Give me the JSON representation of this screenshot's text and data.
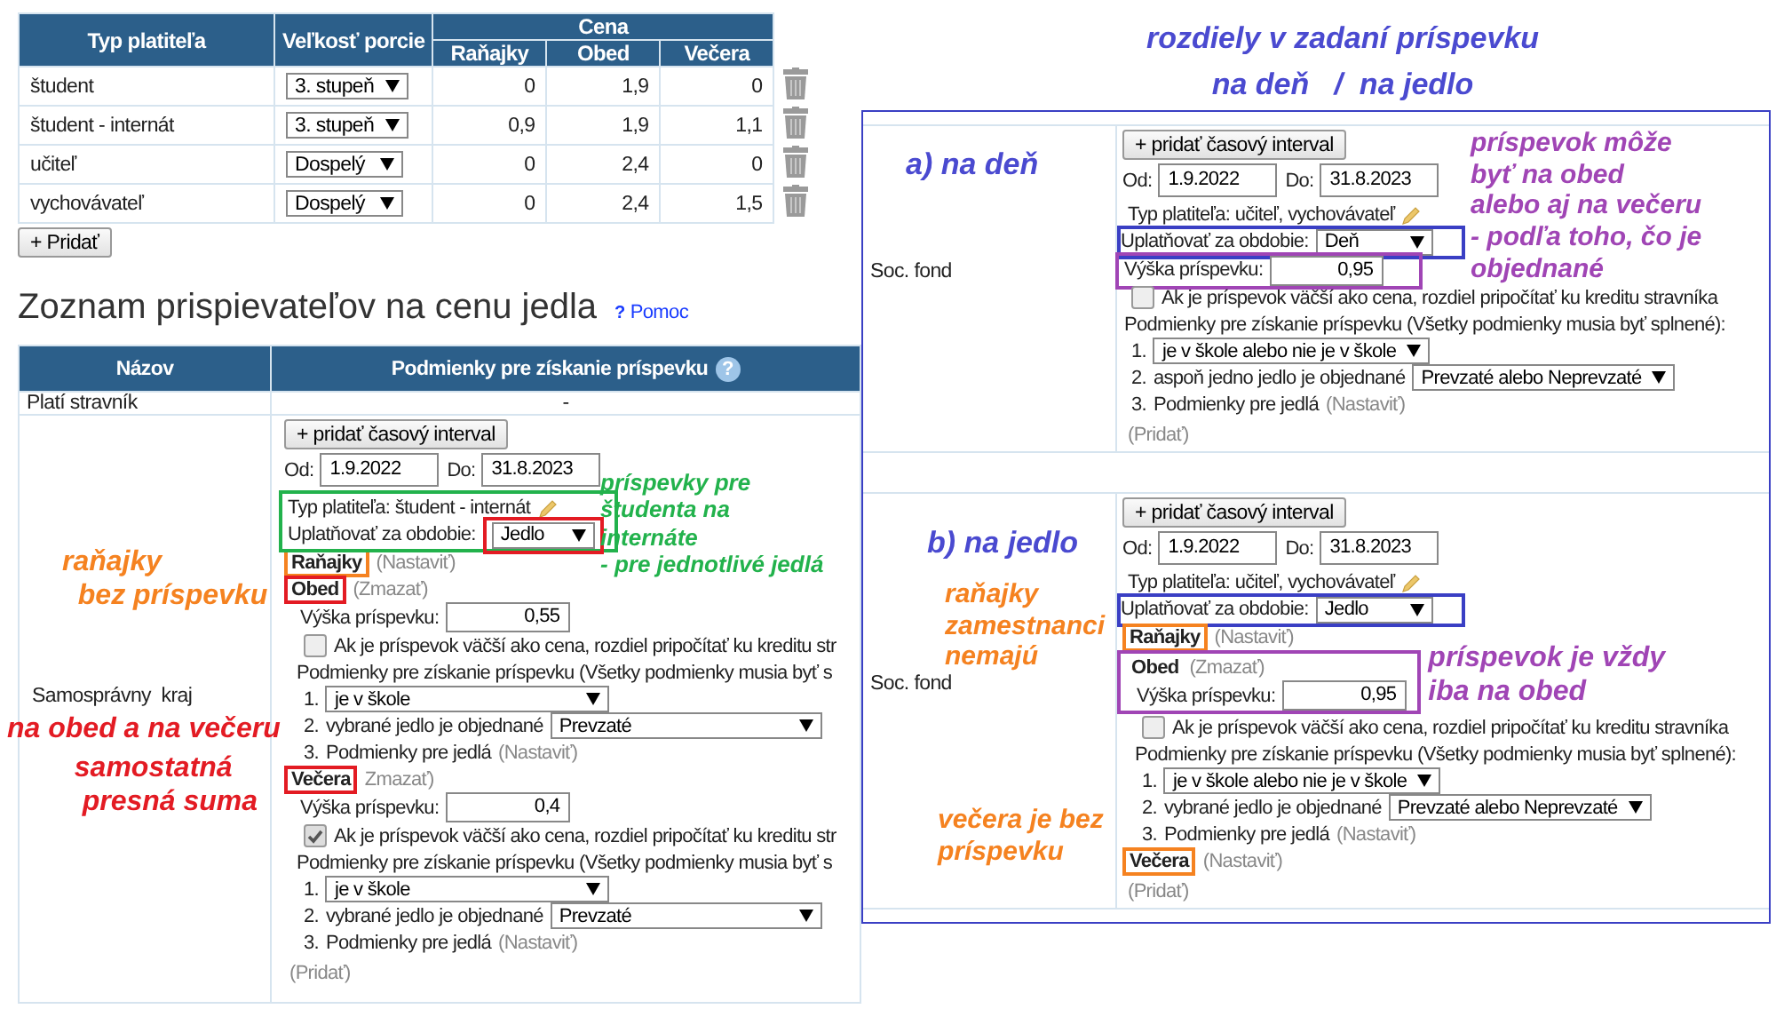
{
  "payer_table": {
    "headers": {
      "payer": "Typ platiteľa",
      "portion": "Veľkosť porcie",
      "price": "Cena",
      "meals": [
        "Raňajky",
        "Obed",
        "Večera"
      ]
    },
    "rows": [
      {
        "payer": "študent",
        "portion": "3. stupeň",
        "prices": [
          "0",
          "1,9",
          "0"
        ]
      },
      {
        "payer": "študent - internát",
        "portion": "3. stupeň",
        "prices": [
          "0,9",
          "1,9",
          "1,1"
        ]
      },
      {
        "payer": "učiteľ",
        "portion": "Dospelý",
        "prices": [
          "0",
          "2,4",
          "0"
        ]
      },
      {
        "payer": "vychovávateľ",
        "portion": "Dospelý",
        "prices": [
          "0",
          "2,4",
          "1,5"
        ]
      }
    ],
    "add_button": "+ Pridať"
  },
  "heading": {
    "title": "Zoznam prispievateľov na cenu jedla",
    "help_mark": "?",
    "help_link": "Pomoc"
  },
  "contributors": {
    "headers": [
      "Názov",
      "Podmienky pre získanie príspevku"
    ],
    "header_help": "?",
    "plain_row": {
      "name": "Platí stravník",
      "value": "-"
    },
    "detail_row": {
      "name_column": [
        {
          "kind": "note",
          "lines": [
            "raňajky",
            "  bez príspevku"
          ],
          "color": "#f58220"
        },
        {
          "kind": "name",
          "text": "Samosprávny  kraj"
        },
        {
          "kind": "note",
          "lines": [
            "na obed a na večeru"
          ],
          "color": "#e31b23"
        },
        {
          "kind": "note",
          "lines": [
            "  samostatná",
            "   presná suma"
          ],
          "color": "#e31b23"
        }
      ],
      "config": {
        "add_interval": "+ pridať časový interval",
        "from_label": "Od:",
        "from": "1.9.2022",
        "to_label": "Do:",
        "to": "31.8.2023",
        "payer_line": "Typ platiteľa: študent - internát",
        "period_label": "Uplatňovať za obdobie:",
        "period": "Jedlo",
        "group_box": {
          "color": "#22b24c"
        },
        "period_box": {
          "kind": "select",
          "color": "#e31b23"
        },
        "side_note": {
          "kind": "beside_group",
          "lines": [
            "príspevky pre",
            "študenta na",
            "internáte",
            "- pre jednotlivé jedlá"
          ],
          "color": "#22b24c"
        },
        "meals": [
          {
            "name": "Raňajky",
            "action": "(Nastaviť)",
            "box": {
              "color": "#f58220"
            }
          },
          {
            "name": "Obed",
            "action": "(Zmazať)",
            "box": {
              "color": "#e31b23"
            },
            "settings": {
              "amount_label": "Výška príspevku:",
              "amount": "0,55",
              "credit_checked": false,
              "credit_text": "Ak je príspevok väčší ako cena, rozdiel pripočítať ku kreditu str",
              "conditions_title": "Podmienky pre získanie príspevku (Všetky podmienky musia byť s",
              "conditions": [
                {
                  "num": "1.",
                  "select": "je v škole"
                },
                {
                  "num": "2.",
                  "label": "vybrané jedlo je objednané",
                  "select": "Prevzaté"
                },
                {
                  "num": "3.",
                  "label": "Podmienky pre jedlá",
                  "link": "(Nastaviť)"
                }
              ]
            }
          },
          {
            "name": "Večera",
            "action": "Zmazať)",
            "box": {
              "color": "#e31b23"
            },
            "settings": {
              "amount_label": "Výška príspevku:",
              "amount": "0,4",
              "credit_checked": true,
              "credit_text": "Ak je príspevok väčší ako cena, rozdiel pripočítať ku kreditu str",
              "conditions_title": "Podmienky pre získanie príspevku (Všetky podmienky musia byť s",
              "conditions": [
                {
                  "num": "1.",
                  "select": "je v škole"
                },
                {
                  "num": "2.",
                  "label": "vybrané jedlo je objednané",
                  "select": "Prevzaté"
                },
                {
                  "num": "3.",
                  "label": "Podmienky pre jedlá",
                  "link": "(Nastaviť)"
                }
              ]
            }
          }
        ],
        "add_link": "(Pridať)"
      }
    }
  },
  "comparison": {
    "title": [
      "rozdiely v zadaní príspevku",
      "na deň   /  na jedlo"
    ],
    "sections": [
      {
        "name_column": [
          {
            "kind": "note",
            "lines": [
              "a) na deň"
            ],
            "color": "#4a4ad0"
          },
          {
            "kind": "name",
            "text": "Soc. fond"
          }
        ],
        "config": {
          "add_interval": "+ pridať časový interval",
          "from_label": "Od:",
          "from": "1.9.2022",
          "to_label": "Do:",
          "to": "31.8.2023",
          "payer_line": "Typ platiteľa: učiteľ, vychovávateľ",
          "period_label": "Uplatňovať za obdobie:",
          "period": "Deň",
          "period_box": {
            "kind": "line",
            "color": "#3a3fc4"
          },
          "side_note": {
            "kind": "beside_top",
            "lines": [
              "príspevok môže",
              "byť na obed",
              "alebo aj na večeru",
              "- podľa toho, čo je",
              "objednané"
            ],
            "color": "#a045b5"
          },
          "settings": {
            "amount_label": "Výška príspevku:",
            "amount": "0,95",
            "amount_box": {
              "color": "#a045b5"
            },
            "credit_checked": false,
            "credit_text": "Ak je príspevok väčší ako cena, rozdiel pripočítať ku kreditu stravníka",
            "conditions_title": "Podmienky pre získanie príspevku (Všetky podmienky musia byť splnené):",
            "conditions": [
              {
                "num": "1.",
                "select": "je v škole alebo nie je v škole"
              },
              {
                "num": "2.",
                "label": "aspoň jedno jedlo je objednané",
                "select": "Prevzaté alebo Neprevzaté"
              },
              {
                "num": "3.",
                "label": "Podmienky pre jedlá",
                "link": "(Nastaviť)"
              }
            ]
          },
          "add_link": "(Pridať)"
        }
      },
      {
        "name_column": [
          {
            "kind": "note",
            "lines": [
              "b) na jedlo"
            ],
            "color": "#4a4ad0"
          },
          {
            "kind": "note",
            "lines": [
              "raňajky",
              "zamestnanci",
              "nemajú"
            ],
            "color": "#f58220"
          },
          {
            "kind": "name",
            "text": "Soc. fond"
          },
          {
            "kind": "note",
            "lines": [
              "večera je bez",
              "príspevku"
            ],
            "color": "#f58220"
          }
        ],
        "config": {
          "add_interval": "+ pridať časový interval",
          "from_label": "Od:",
          "from": "1.9.2022",
          "to_label": "Do:",
          "to": "31.8.2023",
          "payer_line": "Typ platiteľa: učiteľ, vychovávateľ",
          "period_label": "Uplatňovať za obdobie:",
          "period": "Jedlo",
          "period_box": {
            "kind": "line",
            "color": "#3a3fc4"
          },
          "meals": [
            {
              "name": "Raňajky",
              "action": "(Nastaviť)",
              "box": {
                "color": "#f58220"
              }
            },
            {
              "name": "Obed",
              "action": "(Zmazať)",
              "group_box": {
                "color": "#a045b5"
              },
              "group_note": {
                "lines": [
                  "príspevok je vždy",
                  "iba na obed"
                ],
                "color": "#a045b5"
              },
              "settings": {
                "amount_label": "Výška príspevku:",
                "amount": "0,95",
                "credit_checked": false,
                "credit_text": "Ak je príspevok väčší ako cena, rozdiel pripočítať ku kreditu stravníka",
                "conditions_title": "Podmienky pre získanie príspevku (Všetky podmienky musia byť splnené):",
                "conditions": [
                  {
                    "num": "1.",
                    "select": "je v škole alebo nie je v škole"
                  },
                  {
                    "num": "2.",
                    "label": "vybrané jedlo je objednané",
                    "select": "Prevzaté alebo Neprevzaté"
                  },
                  {
                    "num": "3.",
                    "label": "Podmienky pre jedlá",
                    "link": "(Nastaviť)"
                  }
                ]
              }
            },
            {
              "name": "Večera",
              "action": "(Nastaviť)",
              "box": {
                "color": "#f58220"
              }
            }
          ],
          "add_link": "(Pridať)"
        }
      }
    ]
  }
}
